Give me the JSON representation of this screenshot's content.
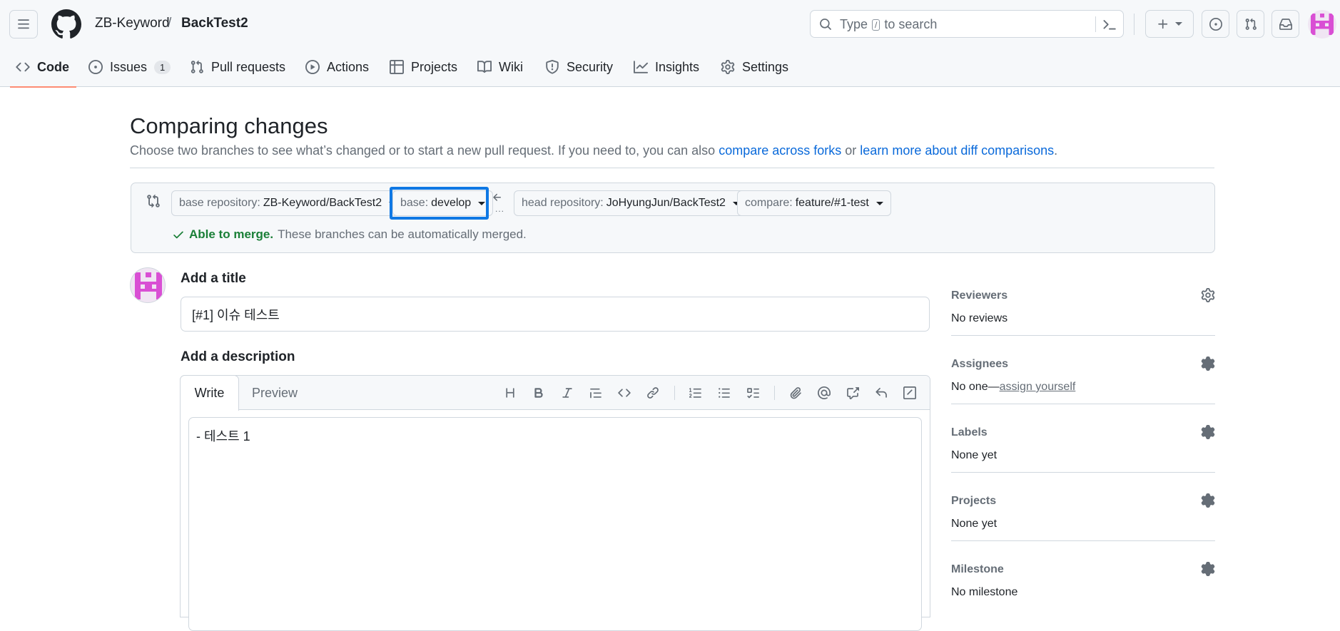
{
  "header": {
    "owner": "ZB-Keyword",
    "separator": "/",
    "repo": "BackTest2",
    "search": {
      "prefix": "Type",
      "key": "/",
      "suffix": "to search"
    }
  },
  "nav": {
    "tabs": [
      {
        "label": "Code",
        "icon": "code-icon",
        "active": true
      },
      {
        "label": "Issues",
        "icon": "issue-opened-icon",
        "count": "1"
      },
      {
        "label": "Pull requests",
        "icon": "git-pull-request-icon"
      },
      {
        "label": "Actions",
        "icon": "play-icon"
      },
      {
        "label": "Projects",
        "icon": "table-icon"
      },
      {
        "label": "Wiki",
        "icon": "book-icon"
      },
      {
        "label": "Security",
        "icon": "shield-icon"
      },
      {
        "label": "Insights",
        "icon": "graph-icon"
      },
      {
        "label": "Settings",
        "icon": "gear-icon"
      }
    ]
  },
  "main": {
    "title": "Comparing changes",
    "subtitle": {
      "text": "Choose two branches to see what’s changed or to start a new pull request. If you need to, you can also",
      "link1": "compare across forks",
      "middle": "or",
      "link2": "learn more about diff comparisons",
      "end": "."
    },
    "range": {
      "base_repo_label": "base repository:",
      "base_repo": "ZB-Keyword/BackTest2",
      "base_label": "base:",
      "base": "develop",
      "head_repo_label": "head repository:",
      "head_repo": "JoHyungJun/BackTest2",
      "compare_label": "compare:",
      "compare": "feature/#1-test",
      "dots": "...",
      "merge_ok": "Able to merge.",
      "merge_text": "These branches can be automatically merged."
    }
  },
  "form": {
    "title_label": "Add a title",
    "title_value": "[#1] 이슈 테스트",
    "description_label": "Add a description",
    "tabs": {
      "write": "Write",
      "preview": "Preview"
    },
    "description_value": "- 테스트 1"
  },
  "sidebar": [
    {
      "heading": "Reviewers",
      "value": "No reviews"
    },
    {
      "heading": "Assignees",
      "value": "No one—",
      "link": "assign yourself"
    },
    {
      "heading": "Labels",
      "value": "None yet"
    },
    {
      "heading": "Projects",
      "value": "None yet"
    },
    {
      "heading": "Milestone",
      "value": "No milestone"
    }
  ],
  "colors": {
    "accent_link": "#0969da",
    "success": "#1a7f37",
    "highlight_box": "#0f78e4",
    "active_tab_underline": "#fd8c73",
    "avatar": "#d94fd4"
  }
}
